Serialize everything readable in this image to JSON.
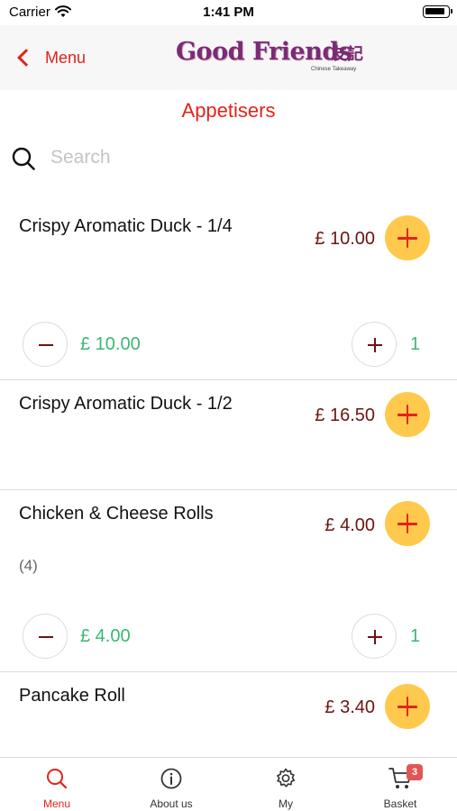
{
  "status_bar": {
    "carrier": "Carrier",
    "time": "1:41 PM"
  },
  "nav": {
    "back_label": "Menu",
    "logo": {
      "main": "Good Friends",
      "chinese": "友記",
      "sub": "Chinese Takeaway"
    }
  },
  "section_title": "Appetisers",
  "search": {
    "placeholder": "Search",
    "value": ""
  },
  "items": [
    {
      "name": "Crispy Aromatic Duck - 1/4",
      "price": "£ 10.00",
      "line_total": "£ 10.00",
      "quantity": "1"
    },
    {
      "name": "Crispy Aromatic Duck - 1/2",
      "price": "£ 16.50"
    },
    {
      "name": "Chicken & Cheese Rolls",
      "price": "£ 4.00",
      "note": "(4)",
      "line_total": "£ 4.00",
      "quantity": "1"
    },
    {
      "name": "Pancake Roll",
      "price": "£ 3.40"
    }
  ],
  "tab_bar": {
    "tabs": [
      {
        "label": "Menu",
        "icon": "search-icon",
        "active": true
      },
      {
        "label": "About us",
        "icon": "info-icon"
      },
      {
        "label": "My",
        "icon": "gear-icon"
      },
      {
        "label": "Basket",
        "icon": "cart-icon",
        "badge": "3"
      }
    ]
  },
  "colors": {
    "accent_red": "#e2231a",
    "price_maroon": "#6b1414",
    "add_button_yellow": "#ffc94d",
    "quantity_green": "#3ab873",
    "logo_purple": "#7a2c73"
  }
}
